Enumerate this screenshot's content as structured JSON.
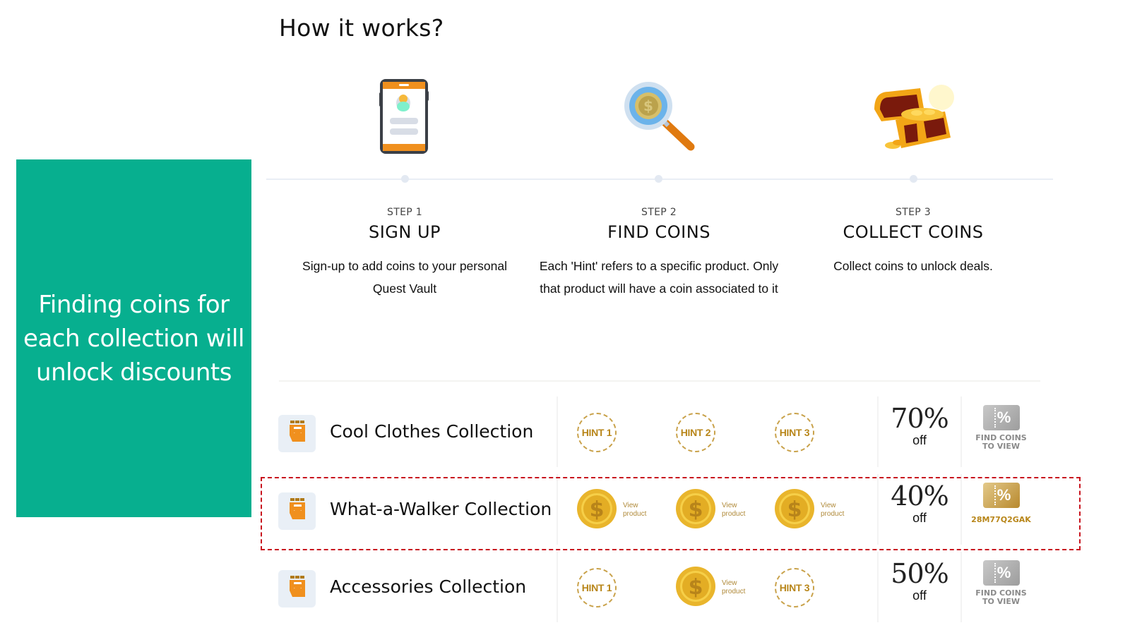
{
  "callout": {
    "text": "Finding coins for each collection will unlock discounts",
    "background": "#07af8f"
  },
  "page": {
    "title": "How it works?"
  },
  "steps": [
    {
      "label": "STEP 1",
      "title": "SIGN UP",
      "description": "Sign-up to add coins to your personal Quest Vault",
      "icon": "smartphone-profile-icon"
    },
    {
      "label": "STEP 2",
      "title": "FIND COINS",
      "description": "Each 'Hint' refers to a specific product. Only that product will have a coin associated to it",
      "icon": "magnifier-coin-icon"
    },
    {
      "label": "STEP 3",
      "title": "COLLECT COINS",
      "description": "Collect coins to unlock deals.",
      "icon": "treasure-chest-icon"
    }
  ],
  "collections": [
    {
      "name": "Cool Clothes Collection",
      "slots": [
        {
          "type": "hint",
          "label": "HINT 1"
        },
        {
          "type": "hint",
          "label": "HINT 2"
        },
        {
          "type": "hint",
          "label": "HINT 3"
        }
      ],
      "discount": "70%",
      "discount_suffix": "off",
      "coupon_state": "locked",
      "coupon_text": "FIND COINS TO VIEW"
    },
    {
      "name": "What-a-Walker Collection",
      "slots": [
        {
          "type": "coin",
          "label": "View product"
        },
        {
          "type": "coin",
          "label": "View product"
        },
        {
          "type": "coin",
          "label": "View product"
        }
      ],
      "discount": "40%",
      "discount_suffix": "off",
      "coupon_state": "unlocked",
      "coupon_code": "28M77Q2GAK",
      "highlighted": true
    },
    {
      "name": "Accessories Collection",
      "slots": [
        {
          "type": "hint",
          "label": "HINT 1"
        },
        {
          "type": "coin",
          "label": "View product"
        },
        {
          "type": "hint",
          "label": "HINT 3"
        }
      ],
      "discount": "50%",
      "discount_suffix": "off",
      "coupon_state": "locked",
      "coupon_text": "FIND COINS TO VIEW"
    }
  ],
  "colors": {
    "accent_gold": "#b8861a",
    "highlight_border": "#c8141e",
    "icon_orange": "#f0901e"
  }
}
